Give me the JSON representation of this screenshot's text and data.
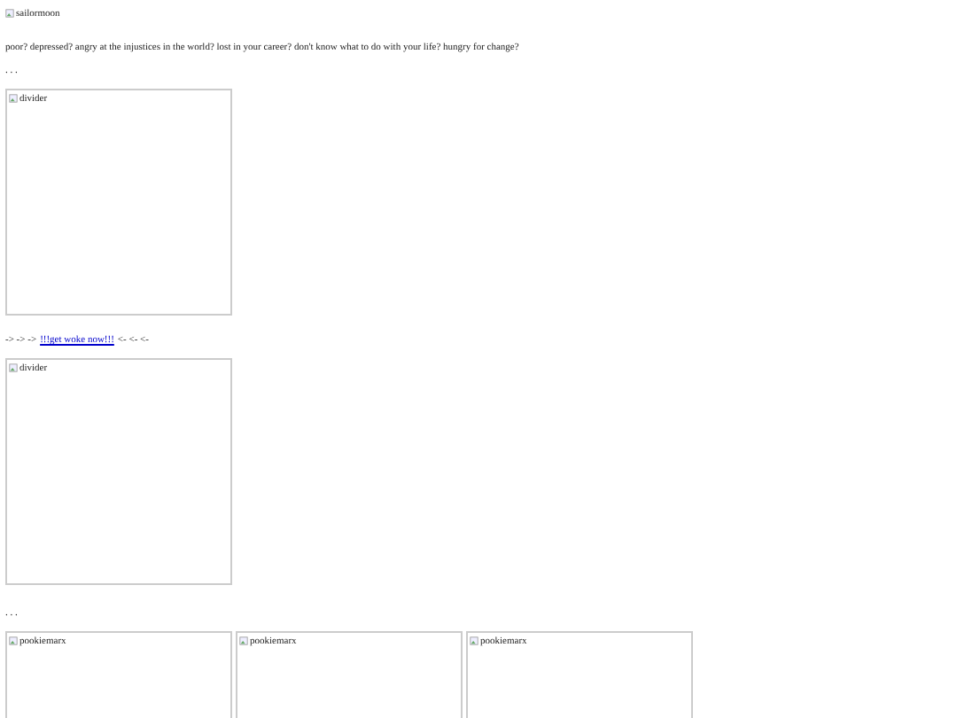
{
  "header_image": {
    "alt": "sailormoon"
  },
  "blocks": [
    {
      "kind": "text",
      "text": "poor? depressed? angry at the injustices in the world? lost in your career? don't know what to do with your life? hungry for change?"
    },
    {
      "kind": "text",
      "text": ". . ."
    },
    {
      "kind": "image",
      "alt": "divider"
    },
    {
      "kind": "link",
      "before": "-> -> ->",
      "link": "!!!get woke now!!!",
      "after": "<- <- <-"
    },
    {
      "kind": "image",
      "alt": "divider"
    },
    {
      "kind": "text",
      "text": ". . ."
    }
  ],
  "gallery": [
    {
      "alt": "pookiemarx"
    },
    {
      "alt": "pookiemarx"
    },
    {
      "alt": "pookiemarx"
    }
  ]
}
